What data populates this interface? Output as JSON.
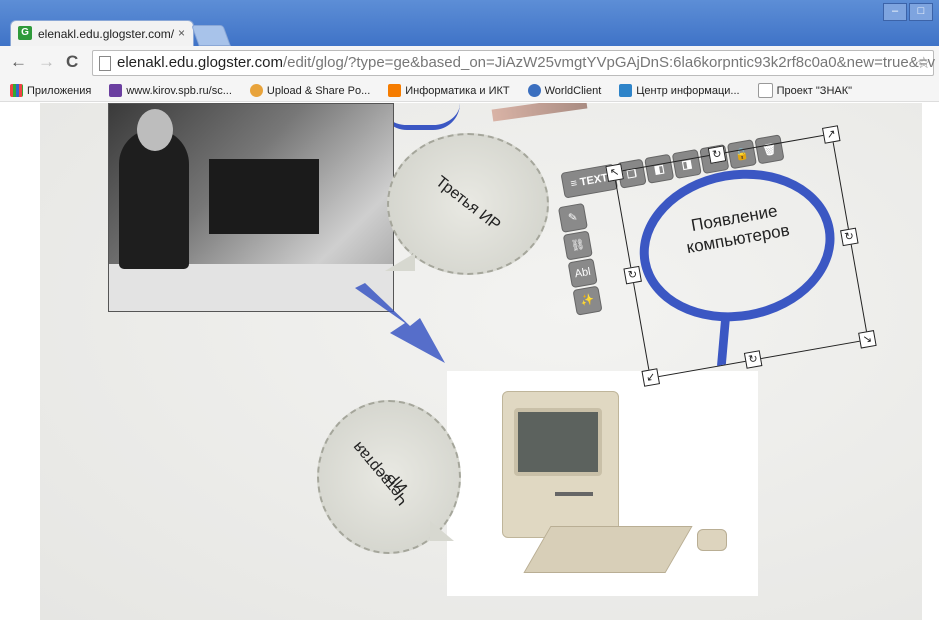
{
  "browser": {
    "tab_title": "elenakl.edu.glogster.com/",
    "tab_close": "×",
    "favicon_letter": "G",
    "window_buttons": [
      "–",
      "□"
    ],
    "url_host": "elenakl.edu.glogster.com",
    "url_rest": "/edit/glog/?type=ge&based_on=JiAzW25vmgtYVpGAjDnS:6la6korpntic93k2rf8c0a0&new=true&=v",
    "nav": {
      "back": "←",
      "forward": "→",
      "reload": "C"
    },
    "bookmarks": [
      {
        "label": "Приложения",
        "icon": "apps-icon",
        "color": "#e44"
      },
      {
        "label": "www.kirov.spb.ru/sc...",
        "icon": "site-icon",
        "color": "#6b3fa0"
      },
      {
        "label": "Upload & Share Po...",
        "icon": "upload-icon",
        "color": "#e8a33b"
      },
      {
        "label": "Информатика и ИКТ",
        "icon": "blogger-icon",
        "color": "#f57c00"
      },
      {
        "label": "WorldClient",
        "icon": "globe-icon",
        "color": "#3b6fbf"
      },
      {
        "label": "Центр информаци...",
        "icon": "center-icon",
        "color": "#2e84c9"
      },
      {
        "label": "Проект \"ЗНАК\"",
        "icon": "page-icon",
        "color": "#ffffff"
      }
    ]
  },
  "glog": {
    "bubble_third": "Третья ИР",
    "bubble_fourth_line1": "Четвертая",
    "bubble_fourth_line2": "ИР",
    "selected_text_line1": "Появление",
    "selected_text_line2": "компьютеров"
  },
  "editor_toolbar": {
    "text_button": "≡ TEXT",
    "buttons": [
      "❐",
      "◧",
      "◨",
      "↶",
      "🔓",
      "🗑"
    ],
    "side": [
      "✎",
      "⛓",
      "Abl",
      "✨"
    ]
  },
  "colors": {
    "accent_blue": "#3b57c3",
    "chrome_blue": "#4a7bcb"
  }
}
